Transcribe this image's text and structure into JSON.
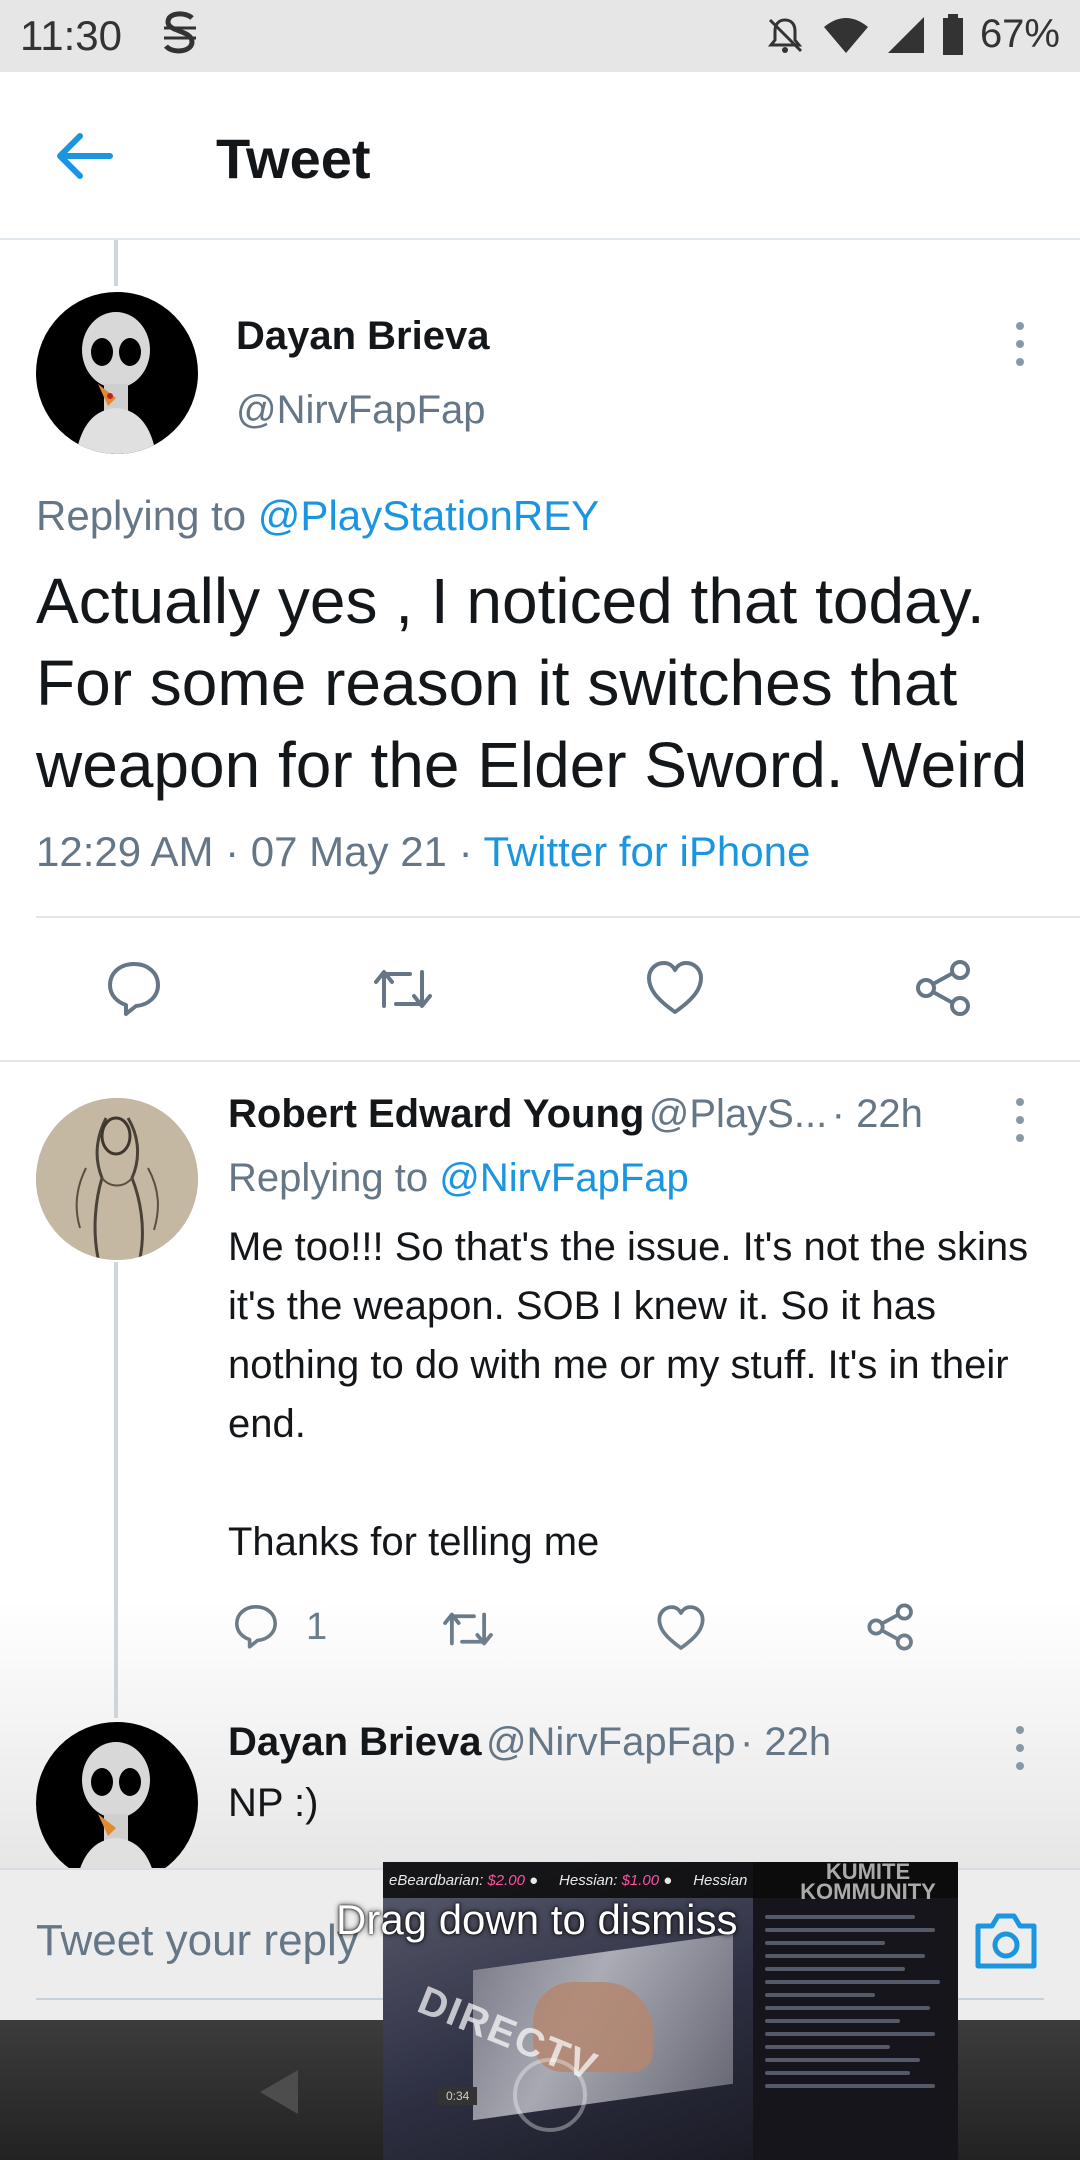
{
  "status_bar": {
    "time": "11:30",
    "battery": "67%",
    "icons": [
      "s-app-icon",
      "mute-icon",
      "wifi-icon",
      "signal-icon",
      "battery-icon"
    ]
  },
  "header": {
    "title": "Tweet",
    "back_icon": "back-arrow-icon"
  },
  "main_tweet": {
    "author_name": "Dayan Brieva",
    "author_handle": "@NirvFapFap",
    "replying_prefix": "Replying to ",
    "replying_to": "@PlayStationREY",
    "text": "Actually yes , I noticed that today. For some reason it switches that weapon for the Elder Sword. Weird",
    "time": "12:29 AM",
    "sep1": " · ",
    "date": "07 May 21",
    "sep2": " · ",
    "source": "Twitter for iPhone",
    "actions": [
      "reply-icon",
      "retweet-icon",
      "like-icon",
      "share-icon"
    ]
  },
  "replies": [
    {
      "author_name": "Robert Edward Young",
      "author_handle": "@PlayS...",
      "age": "· 22h",
      "replying_prefix": "Replying to ",
      "replying_to": "@NirvFapFap",
      "text_p1": "Me too!!! So that's the issue. It's not the skins it's the weapon. SOB I knew it. So it has nothing to do with me or my stuff. It's in their end.",
      "text_p2": "Thanks for telling me",
      "reply_count": "1"
    },
    {
      "author_name": "Dayan Brieva",
      "author_handle": "@NirvFapFap",
      "age": "· 22h",
      "text": "NP :)"
    }
  ],
  "composer": {
    "placeholder": "Tweet your reply",
    "camera_icon": "camera-icon"
  },
  "overlay": {
    "drag_label": "Drag down to dismiss",
    "ticker": [
      {
        "name": "eBeardbarian:",
        "amount": "$2.00"
      },
      {
        "name": "Hessian:",
        "amount": "$1.00"
      },
      {
        "name": "Hessian",
        "amount": ""
      }
    ],
    "brand": "DIRECTV",
    "kumite": "KUMITE KOMMUNITY",
    "timer": "0:34"
  }
}
